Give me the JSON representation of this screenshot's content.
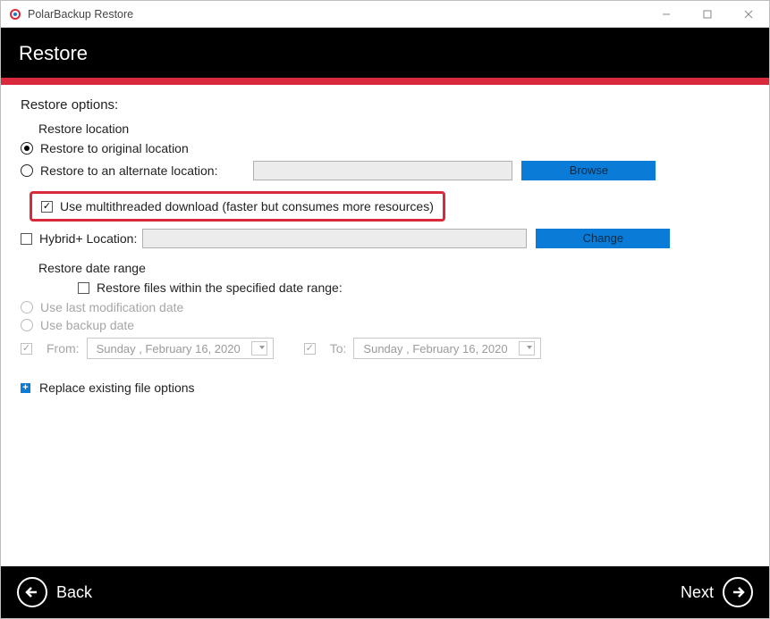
{
  "window": {
    "title": "PolarBackup Restore"
  },
  "banner": {
    "heading": "Restore"
  },
  "options": {
    "title": "Restore options:",
    "location": {
      "heading": "Restore location",
      "original": "Restore to original location",
      "alternate": "Restore to an alternate location:",
      "browse": "Browse"
    },
    "multithread": "Use multithreaded download (faster but consumes more resources)",
    "hybrid": {
      "label": "Hybrid+ Location:",
      "change": "Change"
    },
    "daterange": {
      "heading": "Restore date range",
      "within": "Restore files within the specified date range:",
      "use_mod": "Use last modification date",
      "use_backup": "Use backup date",
      "from_label": "From:",
      "to_label": "To:",
      "from_date": "Sunday   ,  February   16, 2020",
      "to_date": "Sunday   ,  February   16, 2020"
    },
    "replace": "Replace existing file options"
  },
  "footer": {
    "back": "Back",
    "next": "Next"
  }
}
